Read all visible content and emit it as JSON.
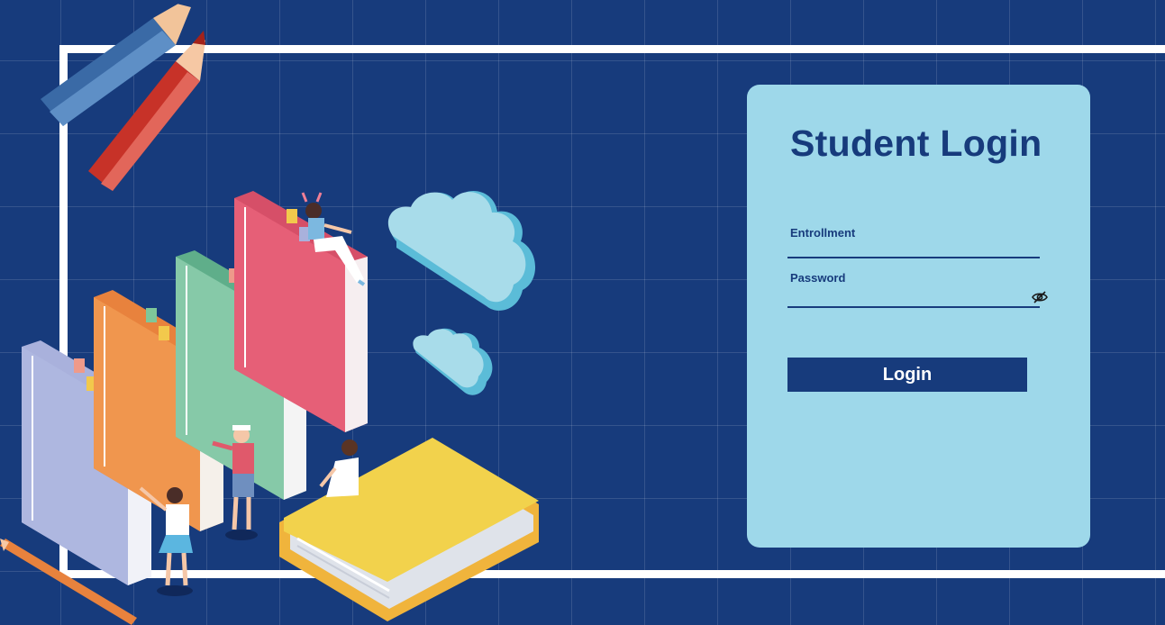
{
  "login": {
    "title": "Student Login",
    "enrollment_label": "Entrollment",
    "enrollment_value": "",
    "password_label": "Password",
    "password_value": "",
    "password_toggle_icon": "eye-slash-icon",
    "button_label": "Login"
  },
  "colors": {
    "background": "#173b7c",
    "card": "#9ed8ea",
    "accent": "#173b7c",
    "button_text": "#ffffff"
  }
}
